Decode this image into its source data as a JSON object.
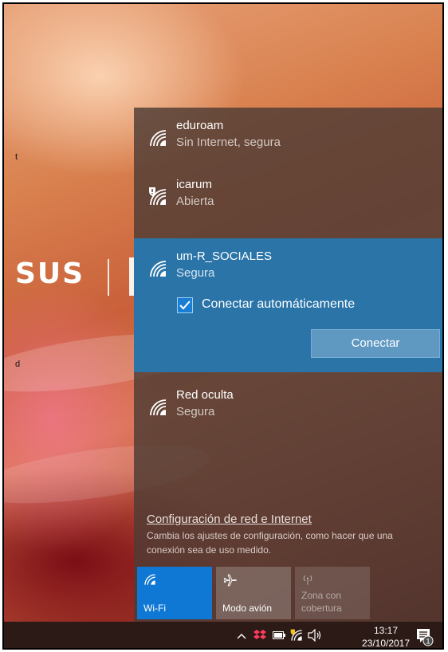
{
  "desktop": {
    "logo_text": "SUS",
    "edge_text_1": "t",
    "edge_text_2": "d"
  },
  "networks": [
    {
      "name": "eduroam",
      "status": "Sin Internet, segura",
      "icon": "wifi-signal-icon"
    },
    {
      "name": "icarum",
      "status": "Abierta",
      "icon": "wifi-shield-icon"
    },
    {
      "name": "um-R_SOCIALES",
      "status": "Segura",
      "icon": "wifi-signal-icon",
      "selected": true,
      "auto_connect_label": "Conectar automáticamente",
      "auto_connect_checked": true,
      "connect_label": "Conectar"
    },
    {
      "name": "Red oculta",
      "status": "Segura",
      "icon": "wifi-signal-icon"
    }
  ],
  "settings": {
    "link": "Configuración de red e Internet",
    "description": "Cambia los ajustes de configuración, como hacer que una conexión sea de uso medido."
  },
  "quick_actions": [
    {
      "label": "Wi-Fi",
      "icon": "wifi-icon",
      "active": true
    },
    {
      "label": "Modo avión",
      "icon": "airplane-icon",
      "active": false
    },
    {
      "label": "Zona con cobertura",
      "icon": "hotspot-icon",
      "active": false,
      "disabled": true
    }
  ],
  "taskbar": {
    "time": "13:17",
    "date": "23/10/2017",
    "notification_count": "1"
  },
  "colors": {
    "accent": "#0f78d4",
    "selected_network": "#2a74a8",
    "connect_button": "#5f99c2",
    "flyout_bg": "#4e3c34",
    "taskbar_bg": "#2b1a16"
  }
}
